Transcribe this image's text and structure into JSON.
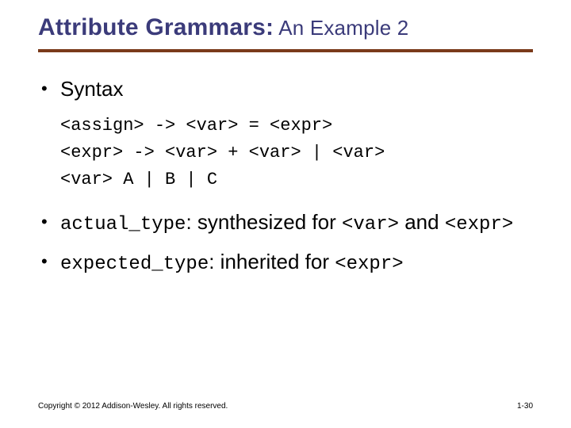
{
  "title": {
    "main": "Attribute Grammars:",
    "sub": " An Example 2"
  },
  "bullets": {
    "b1": "Syntax",
    "code": "<assign> -> <var> = <expr>\n<expr> -> <var> + <var> | <var>\n<var> A | B | C",
    "b2_code": "actual_type",
    "b2_text_a": ": synthesized for ",
    "b2_nt1": "<var>",
    "b2_text_b": " and ",
    "b2_nt2": "<expr>",
    "b3_code": "expected_type",
    "b3_text_a": ": inherited for ",
    "b3_nt1": "<expr>"
  },
  "footer": {
    "copyright": "Copyright © 2012 Addison-Wesley. All rights reserved.",
    "page": "1-30"
  }
}
